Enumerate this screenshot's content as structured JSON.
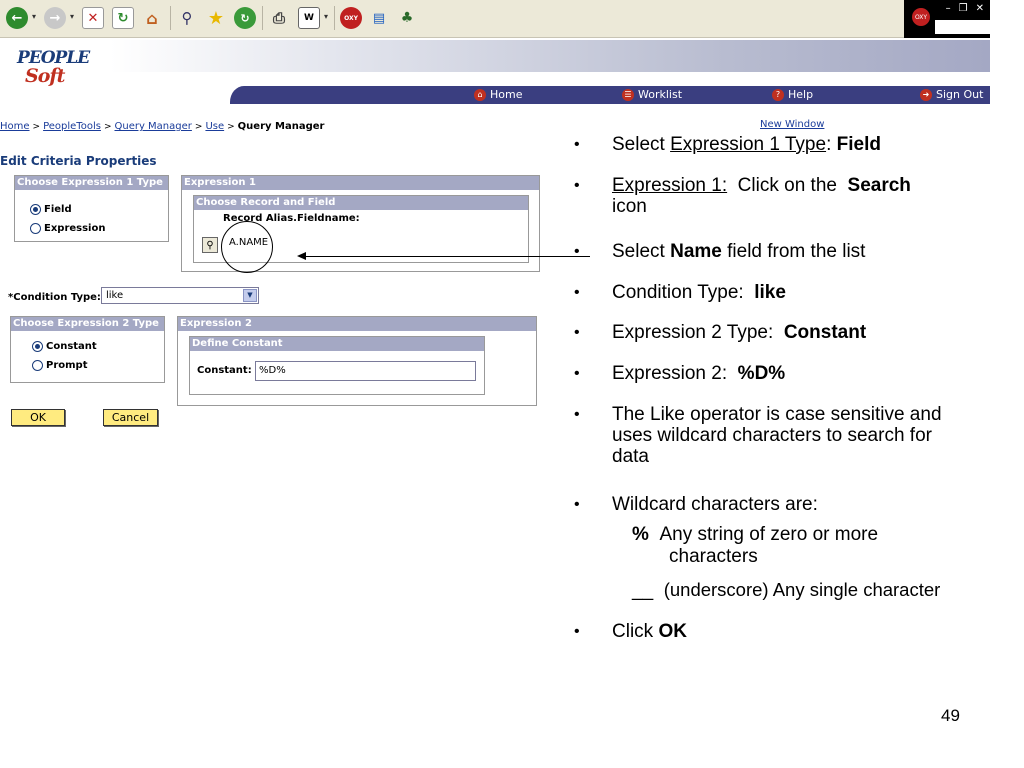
{
  "browser": {
    "buttons": [
      "back-icon",
      "forward-icon",
      "stop-icon",
      "refresh-icon",
      "home-icon",
      "search-icon",
      "favorites-icon",
      "history-icon",
      "print-icon",
      "edit-icon",
      "oxy-icon",
      "tool-icon",
      "share-icon"
    ],
    "window_controls": [
      "minimize-icon",
      "restore-icon",
      "close-icon"
    ]
  },
  "header": {
    "logo_line1": "PEOPLE",
    "logo_line2": "Soft",
    "nav": [
      {
        "label": "Home",
        "icon": "home-icon",
        "color": "#c03020"
      },
      {
        "label": "Worklist",
        "icon": "worklist-icon",
        "color": "#c03020"
      },
      {
        "label": "Help",
        "icon": "help-icon",
        "color": "#c03020"
      },
      {
        "label": "Sign Out",
        "icon": "sign-out-icon",
        "color": "#c03020"
      }
    ]
  },
  "breadcrumb": {
    "items": [
      "Home",
      "PeopleTools",
      "Query Manager",
      "Use"
    ],
    "current": "Query Manager",
    "separator": ">"
  },
  "new_window": "New Window",
  "page_title": "Edit Criteria Properties",
  "expr1_type": {
    "heading": "Choose Expression 1 Type",
    "options": [
      {
        "label": "Field",
        "selected": true
      },
      {
        "label": "Expression",
        "selected": false
      }
    ]
  },
  "expr1": {
    "heading": "Expression 1",
    "sub_heading": "Choose Record and Field",
    "field_label": "Record Alias.Fieldname:",
    "field_value": "A.NAME"
  },
  "condition": {
    "label": "*Condition Type:",
    "value": "like"
  },
  "expr2_type": {
    "heading": "Choose Expression 2 Type",
    "options": [
      {
        "label": "Constant",
        "selected": true
      },
      {
        "label": "Prompt",
        "selected": false
      }
    ]
  },
  "expr2": {
    "heading": "Expression 2",
    "sub_heading": "Define Constant",
    "constant_label": "Constant:",
    "constant_value": "%D%"
  },
  "buttons": {
    "ok": "OK",
    "cancel": "Cancel"
  },
  "bullets": {
    "marker": "•",
    "b1": {
      "pre": "Select ",
      "link": "Expression 1 Type",
      "mid": ": ",
      "bold": "Field"
    },
    "b2": {
      "link": "Expression 1:",
      "mid": "  Click on the  ",
      "bold": "Search",
      "post": "icon"
    },
    "b3": {
      "pre": "Select ",
      "bold": "Name",
      "post": " field from the list"
    },
    "b4": {
      "pre": "Condition Type:  ",
      "bold": "like"
    },
    "b5": {
      "pre": "Expression 2 Type:  ",
      "bold": "Constant"
    },
    "b6": {
      "pre": "Expression 2:  ",
      "bold": "%D%"
    },
    "b7": {
      "line1": "The Like operator is case sensitive and",
      "line2": "uses wildcard characters to search for",
      "line3": "data"
    },
    "b8": {
      "pre": "Wildcard characters are:"
    },
    "sub1": {
      "symbol": "%",
      "line1": "Any string of zero or more",
      "line2": "characters"
    },
    "sub2": {
      "symbol": "__",
      "text": "(underscore) Any single character"
    },
    "b9": {
      "pre": "Click ",
      "bold": "OK"
    }
  },
  "page_number": "49"
}
